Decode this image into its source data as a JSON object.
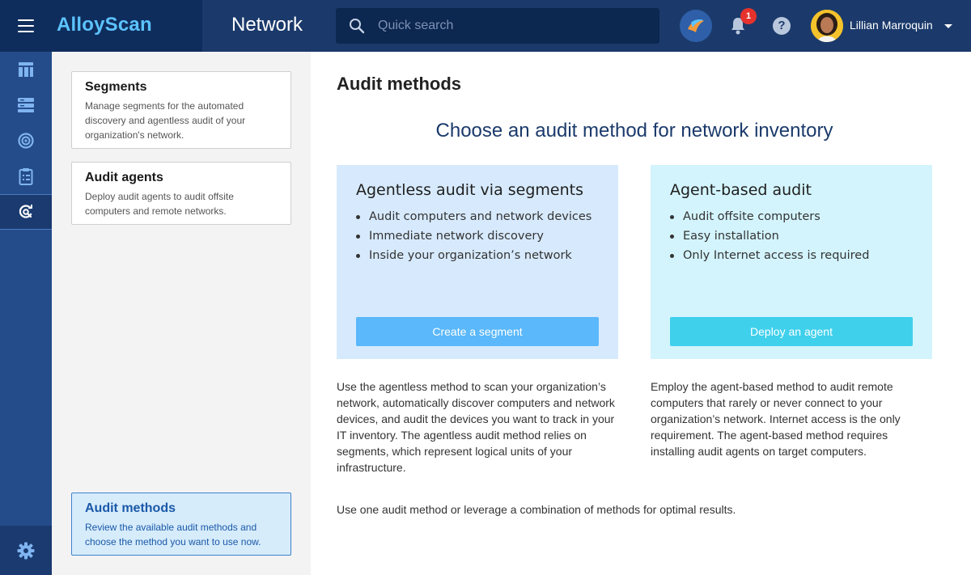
{
  "app": {
    "brand": "AlloyScan",
    "section": "Network"
  },
  "search": {
    "placeholder": "Quick search"
  },
  "header": {
    "notification_count": "1",
    "help_label": "?",
    "user_name": "Lillian Marroquin"
  },
  "rail": {
    "items": [
      "dashboard-icon",
      "inventory-icon",
      "target-icon",
      "clipboard-icon",
      "network-scan-icon"
    ],
    "active": "network-scan-icon",
    "bottom": "gear-icon"
  },
  "subnav": {
    "items": [
      {
        "title": "Segments",
        "description": "Manage segments for the automated discovery and agentless audit of your organization's network."
      },
      {
        "title": "Audit agents",
        "description": "Deploy audit agents to audit offsite computers and remote networks."
      },
      {
        "title": "Audit methods",
        "description": "Review the available audit methods and choose the method you want to use now."
      }
    ]
  },
  "main": {
    "title": "Audit methods",
    "subtitle": "Choose an audit method for network inventory",
    "methods": [
      {
        "title": "Agentless audit via segments",
        "bullets": [
          "Audit computers and network devices",
          "Immediate network discovery",
          "Inside your organization’s network"
        ],
        "button": "Create a segment",
        "description": "Use the agentless method to scan your organization’s network, automatically discover computers and network devices, and audit the devices you want to track in your IT inventory. The agentless audit method relies on segments, which represent logical units of your infrastructure."
      },
      {
        "title": "Agent-based audit",
        "bullets": [
          "Audit offsite computers",
          "Easy installation",
          "Only Internet access is required"
        ],
        "button": "Deploy an agent",
        "description": "Employ the agent-based method to audit remote computers that rarely or never connect to your organization’s network. Internet access is the only requirement. The agent-based method requires installing audit agents on target computers."
      }
    ],
    "footer": "Use one audit method or leverage a combination of methods for optimal results."
  },
  "colors": {
    "topbar": "#1b3a6b",
    "brand": "#5cc3ff",
    "rail": "#254c8a",
    "agentless_bg": "#d7eafd",
    "agent_bg": "#d3f4fd",
    "agentless_button": "#5ab8fb",
    "agent_button": "#3fd0ec"
  }
}
